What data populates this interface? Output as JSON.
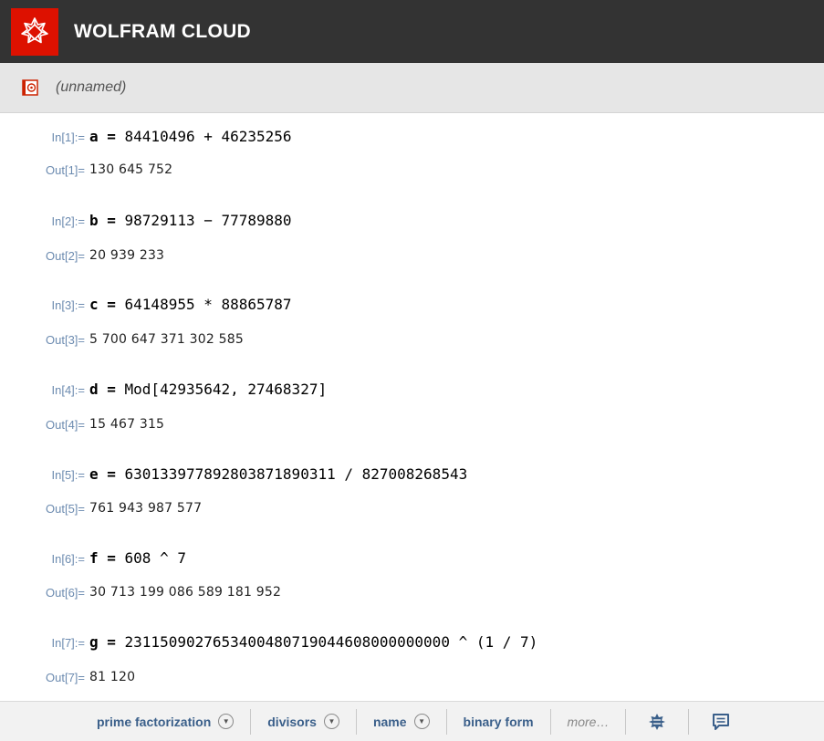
{
  "header": {
    "brand": "WOLFRAM CLOUD",
    "logo_icon": "wolfram-spikey-icon",
    "background": "#333333",
    "logo_color": "#dd1100"
  },
  "document": {
    "name": "(unnamed)",
    "icon": "notebook-icon"
  },
  "cells": [
    {
      "in_label": "In[1]:=",
      "input_var": "a = ",
      "input_expr": "84410496 + 46235256",
      "out_label": "Out[1]=",
      "output": "130 645 752"
    },
    {
      "in_label": "In[2]:=",
      "input_var": "b = ",
      "input_expr": "98729113 − 77789880",
      "out_label": "Out[2]=",
      "output": "20 939 233"
    },
    {
      "in_label": "In[3]:=",
      "input_var": "c = ",
      "input_expr": "64148955 * 88865787",
      "out_label": "Out[3]=",
      "output": "5 700 647 371 302 585"
    },
    {
      "in_label": "In[4]:=",
      "input_var": "d = ",
      "input_expr": "Mod[42935642, 27468327]",
      "out_label": "Out[4]=",
      "output": "15 467 315"
    },
    {
      "in_label": "In[5]:=",
      "input_var": "e = ",
      "input_expr": "630133977892803871890311 / 827008268543",
      "out_label": "Out[5]=",
      "output": "761 943 987 577"
    },
    {
      "in_label": "In[6]:=",
      "input_var": "f = ",
      "input_expr": "608 ^ 7",
      "out_label": "Out[6]=",
      "output": "30 713 199 086 589 181 952"
    },
    {
      "in_label": "In[7]:=",
      "input_var": "g = ",
      "input_expr": "2311509027653400480719044608000000000 ^ (1 / 7)",
      "out_label": "Out[7]=",
      "output": "81 120"
    }
  ],
  "suggestions": {
    "items": [
      {
        "label": "prime factorization",
        "dropdown": true
      },
      {
        "label": "divisors",
        "dropdown": true
      },
      {
        "label": "name",
        "dropdown": true
      },
      {
        "label": "binary form",
        "dropdown": false
      }
    ],
    "more_label": "more…",
    "icons": [
      "wolfram-alpha-icon",
      "feedback-icon"
    ]
  },
  "colors": {
    "label": "#6c8bb0",
    "suggestion_text": "#3a5f8a"
  }
}
